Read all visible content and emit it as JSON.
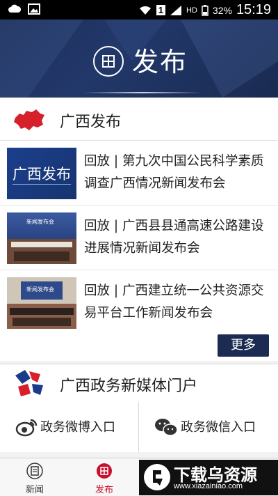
{
  "status_bar": {
    "battery_percent": "32%",
    "time": "15:19",
    "sim_label": "1",
    "network_label": "HD"
  },
  "header": {
    "title": "发布"
  },
  "release_section": {
    "title": "广西发布",
    "items": [
      {
        "text": "回放 | 第九次中国公民科学素质调查广西情况新闻发布会",
        "thumb_text": "广西发布"
      },
      {
        "text": "回放 | 广西县县通高速公路建设进展情况新闻发布会",
        "thumb_text": "新闻发布会"
      },
      {
        "text": "回放 | 广西建立统一公共资源交易平台工作新闻发布会",
        "thumb_text": "新闻发布会"
      }
    ],
    "more_label": "更多"
  },
  "portal_section": {
    "title": "广西政务新媒体门户",
    "weibo_label": "政务微博入口",
    "wechat_label": "政务微信入口"
  },
  "bottom_nav": {
    "items": [
      {
        "label": "新闻",
        "color": "#333333"
      },
      {
        "label": "发布",
        "color": "#c8102e"
      }
    ]
  },
  "watermark": {
    "brand": "下载乌资源",
    "url": "www.xiazainiao.com"
  },
  "colors": {
    "header_bg": "#1d2f57",
    "more_button": "#1b2b52",
    "accent_red": "#c8102e",
    "map_red": "#d6202a"
  }
}
